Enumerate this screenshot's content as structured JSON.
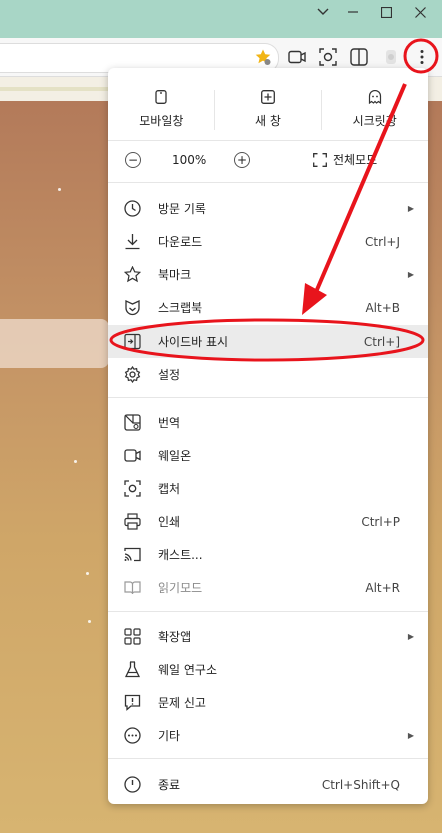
{
  "window": {
    "controls": [
      "chevron-down-icon",
      "minimize-icon",
      "maximize-icon",
      "close-icon"
    ]
  },
  "toolbar": {
    "icons": [
      "favorite-star-icon",
      "pip-icon",
      "capture-icon",
      "split-view-icon",
      "extension-icon",
      "more-menu-icon"
    ]
  },
  "menu": {
    "top_buttons": [
      {
        "label": "모바일창",
        "icon": "mobile-window-icon"
      },
      {
        "label": "새 창",
        "icon": "new-window-icon"
      },
      {
        "label": "시크릿창",
        "icon": "secret-window-icon"
      }
    ],
    "zoom": {
      "minus": "−",
      "value": "100%",
      "plus": "+",
      "fullscreen_label": "전체모드"
    },
    "group1": [
      {
        "label": "방문 기록",
        "icon": "history-icon",
        "shortcut": "",
        "submenu": true
      },
      {
        "label": "다운로드",
        "icon": "download-icon",
        "shortcut": "Ctrl+J",
        "submenu": false
      },
      {
        "label": "북마크",
        "icon": "star-icon",
        "shortcut": "",
        "submenu": true
      },
      {
        "label": "스크랩북",
        "icon": "scrapbook-icon",
        "shortcut": "Alt+B",
        "submenu": false
      },
      {
        "label": "사이드바 표시",
        "icon": "sidebar-icon",
        "shortcut": "Ctrl+]",
        "submenu": false
      },
      {
        "label": "설정",
        "icon": "gear-icon",
        "shortcut": "",
        "submenu": false
      }
    ],
    "group2": [
      {
        "label": "번역",
        "icon": "translate-icon",
        "shortcut": "",
        "submenu": false
      },
      {
        "label": "웨일온",
        "icon": "whale-on-icon",
        "shortcut": "",
        "submenu": false
      },
      {
        "label": "캡처",
        "icon": "capture-icon",
        "shortcut": "",
        "submenu": false
      },
      {
        "label": "인쇄",
        "icon": "print-icon",
        "shortcut": "Ctrl+P",
        "submenu": false
      },
      {
        "label": "캐스트...",
        "icon": "cast-icon",
        "shortcut": "",
        "submenu": false
      },
      {
        "label": "읽기모드",
        "icon": "reader-mode-icon",
        "shortcut": "Alt+R",
        "submenu": false,
        "disabled": true
      }
    ],
    "group3": [
      {
        "label": "확장앱",
        "icon": "extensions-icon",
        "shortcut": "",
        "submenu": true
      },
      {
        "label": "웨일 연구소",
        "icon": "lab-flask-icon",
        "shortcut": "",
        "submenu": false
      },
      {
        "label": "문제 신고",
        "icon": "report-icon",
        "shortcut": "",
        "submenu": false
      },
      {
        "label": "기타",
        "icon": "more-icon",
        "shortcut": "",
        "submenu": true
      }
    ],
    "quit": {
      "label": "종료",
      "icon": "power-icon",
      "shortcut": "Ctrl+Shift+Q"
    }
  },
  "annotation": {
    "color": "#e8141c"
  }
}
